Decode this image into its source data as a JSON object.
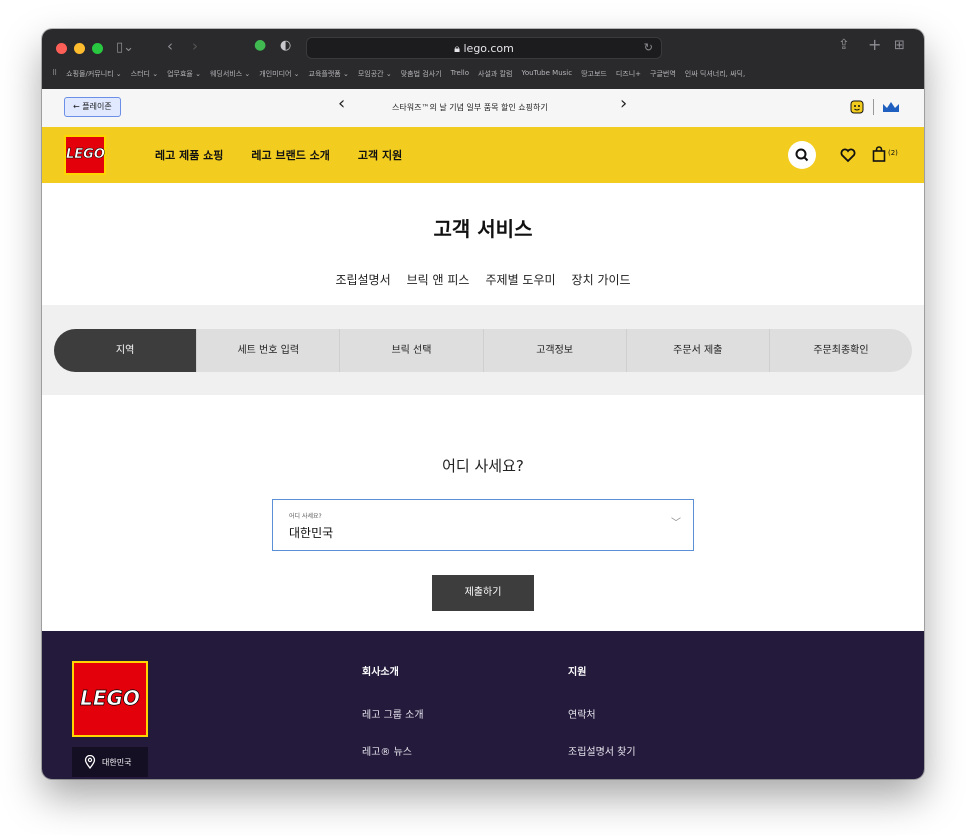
{
  "browser": {
    "url": "lego.com",
    "favorites": [
      "쇼핑몰/커뮤니티 ⌄",
      "스터디 ⌄",
      "업무효율 ⌄",
      "웨딩서비스 ⌄",
      "개인미디어 ⌄",
      "교육플랫폼 ⌄",
      "모임공간 ⌄",
      "맞춤법 검사기",
      "Trello",
      "사설과 칼럼",
      "YouTube Music",
      "땅고보드",
      "디즈니+",
      "구글번역",
      "인싸 딕셔너리, 싸딕,"
    ]
  },
  "promo": {
    "back_label": "← 플레이존",
    "message": "스타워즈™의 날 기념 일부 품목 할인  쇼핑하기"
  },
  "header": {
    "logo": "LEGO",
    "nav": [
      "레고 제품 쇼핑",
      "레고 브랜드 소개",
      "고객 지원"
    ],
    "cart_count": "(2)"
  },
  "page": {
    "title": "고객 서비스",
    "subnav": [
      "조립설명서",
      "브릭 앤 피스",
      "주제별 도우미",
      "장치 가이드"
    ]
  },
  "steps": [
    "지역",
    "세트 번호 입력",
    "브릭 선택",
    "고객정보",
    "주문서 제출",
    "주문최종확인"
  ],
  "form": {
    "question": "어디 사세요?",
    "field_label": "어디 사세요?",
    "field_value": "대한민국",
    "submit_label": "제출하기"
  },
  "footer": {
    "logo": "LEGO",
    "region": "대한민국",
    "col1_title": "회사소개",
    "col1_links": [
      "레고 그룹 소개",
      "레고® 뉴스"
    ],
    "col2_title": "지원",
    "col2_links": [
      "연락처",
      "조립설명서 찾기"
    ]
  },
  "colors": {
    "lego_yellow": "#f2cd1f",
    "lego_red": "#e3000b",
    "footer_bg": "#241a3c"
  }
}
